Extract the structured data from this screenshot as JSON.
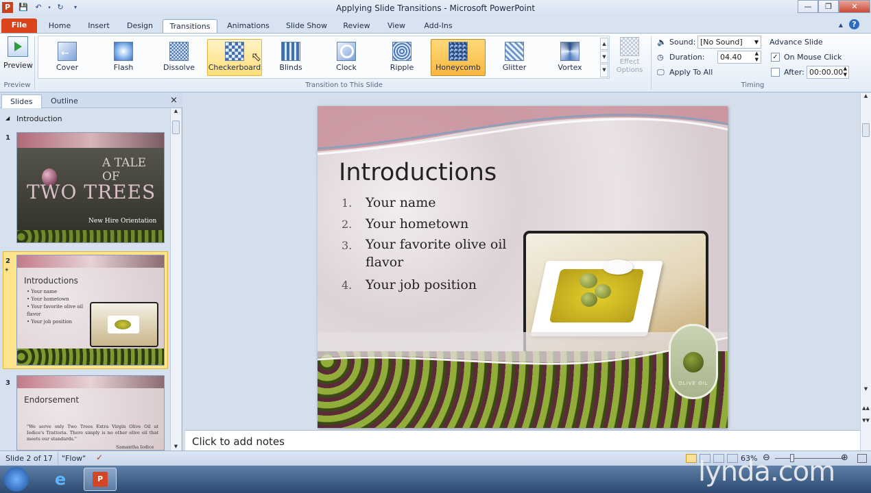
{
  "window": {
    "title": "Applying Slide Transitions - Microsoft PowerPoint"
  },
  "tabs": [
    {
      "label": "File"
    },
    {
      "label": "Home"
    },
    {
      "label": "Insert"
    },
    {
      "label": "Design"
    },
    {
      "label": "Transitions"
    },
    {
      "label": "Animations"
    },
    {
      "label": "Slide Show"
    },
    {
      "label": "Review"
    },
    {
      "label": "View"
    },
    {
      "label": "Add-Ins"
    }
  ],
  "ribbon": {
    "preview_label": "Preview",
    "preview_group": "Preview",
    "transitions": [
      {
        "label": "Cover"
      },
      {
        "label": "Flash"
      },
      {
        "label": "Dissolve"
      },
      {
        "label": "Checkerboard"
      },
      {
        "label": "Blinds"
      },
      {
        "label": "Clock"
      },
      {
        "label": "Ripple"
      },
      {
        "label": "Honeycomb"
      },
      {
        "label": "Glitter"
      },
      {
        "label": "Vortex"
      }
    ],
    "transition_group": "Transition to This Slide",
    "effect_options": "Effect Options",
    "timing": {
      "sound_label": "Sound:",
      "sound_value": "[No Sound]",
      "duration_label": "Duration:",
      "duration_value": "04.40",
      "apply_all": "Apply To All",
      "advance_label": "Advance Slide",
      "on_click_label": "On Mouse Click",
      "after_label": "After:",
      "after_value": "00:00.00",
      "group": "Timing"
    }
  },
  "left_pane": {
    "tab_slides": "Slides",
    "tab_outline": "Outline",
    "close": "×",
    "section": "Introduction",
    "slides": [
      {
        "num": "1",
        "title_top": "A TALE OF",
        "title_big": "TWO TREES",
        "subtitle": "New Hire Orientation"
      },
      {
        "num": "2",
        "title": "Introductions",
        "bullets": [
          "Your name",
          "Your hometown",
          "Your favorite olive oil flavor",
          "Your job position"
        ]
      },
      {
        "num": "3",
        "title": "Endorsement",
        "quote": "\"We serve only Two Trees Extra Virgin Olive Oil at Iodice's Trattoria. There simply is no other olive oil that meets our standards.\"",
        "author": "Samantha Iodice"
      }
    ]
  },
  "slide": {
    "title": "Introductions",
    "items": [
      {
        "n": "1.",
        "text": "Your name"
      },
      {
        "n": "2.",
        "text": "Your hometown"
      },
      {
        "n": "3.",
        "text": "Your favorite olive oil flavor"
      },
      {
        "n": "4.",
        "text": "Your job position"
      }
    ],
    "badge": "OLIVE OIL"
  },
  "notes": {
    "placeholder": "Click to add notes"
  },
  "status": {
    "slide_info": "Slide 2 of 17",
    "theme": "\"Flow\"",
    "zoom": "63%"
  },
  "watermark": "lynda.com"
}
